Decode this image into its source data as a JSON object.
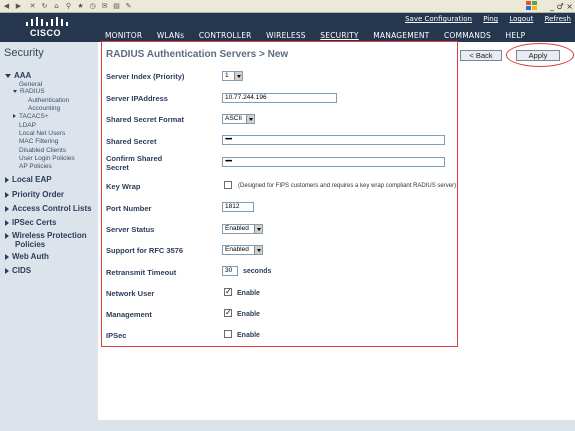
{
  "header": {
    "logo_text": "CISCO",
    "links": [
      "Save Configuration",
      "Ping",
      "Logout",
      "Refresh"
    ],
    "nav": [
      "MONITOR",
      "WLANs",
      "CONTROLLER",
      "WIRELESS",
      "SECURITY",
      "MANAGEMENT",
      "COMMANDS",
      "HELP"
    ],
    "active_nav": "SECURITY"
  },
  "window": {
    "controls": "_ ♂ ×"
  },
  "sidebar": {
    "title": "Security",
    "aaa": "AAA",
    "general": "General",
    "radius": "RADIUS",
    "authentication": "Authentication",
    "accounting": "Accounting",
    "tacacs": "TACACS+",
    "ldap": "LDAP",
    "local_net_users": "Local Net Users",
    "mac_filtering": "MAC Filtering",
    "disabled_clients": "Disabled Clients",
    "user_login_policies": "User Login Policies",
    "ap_policies": "AP Policies",
    "local_eap": "Local EAP",
    "priority_order": "Priority Order",
    "access_control_lists": "Access Control Lists",
    "ipsec_certs": "IPSec Certs",
    "wireless_protection_policies_1": "Wireless Protection",
    "wireless_protection_policies_2": "Policies",
    "web_auth": "Web Auth",
    "cids": "CIDS"
  },
  "page": {
    "title": "RADIUS Authentication Servers > New",
    "back_label": "< Back",
    "apply_label": "Apply"
  },
  "form": {
    "server_index_label": "Server Index (Priority)",
    "server_index_value": "1",
    "server_ip_label": "Server IPAddress",
    "server_ip_value": "10.77.244.196",
    "secret_format_label": "Shared Secret Format",
    "secret_format_value": "ASCII",
    "shared_secret_label": "Shared Secret",
    "shared_secret_value": "•••••",
    "confirm_secret_label_1": "Confirm Shared",
    "confirm_secret_label_2": "Secret",
    "confirm_secret_value": "•••••",
    "key_wrap_label": "Key Wrap",
    "key_wrap_note": "(Designed for FIPS customers and requires a key wrap compliant RADIUS server)",
    "port_label": "Port Number",
    "port_value": "1812",
    "server_status_label": "Server Status",
    "server_status_value": "Enabled",
    "rfc_label": "Support for RFC 3576",
    "rfc_value": "Enabled",
    "retransmit_label": "Retransmit Timeout",
    "retransmit_value": "30",
    "retransmit_unit": "seconds",
    "network_user_label": "Network User",
    "network_user_checked": true,
    "network_user_text": "Enable",
    "management_label": "Management",
    "management_checked": true,
    "management_text": "Enable",
    "ipsec_label": "IPSec",
    "ipsec_checked": false,
    "ipsec_text": "Enable"
  },
  "colors": {
    "header_bg": "#25374e",
    "sidebar_bg": "#dde3ea",
    "highlight_red": "#e03a3a"
  }
}
